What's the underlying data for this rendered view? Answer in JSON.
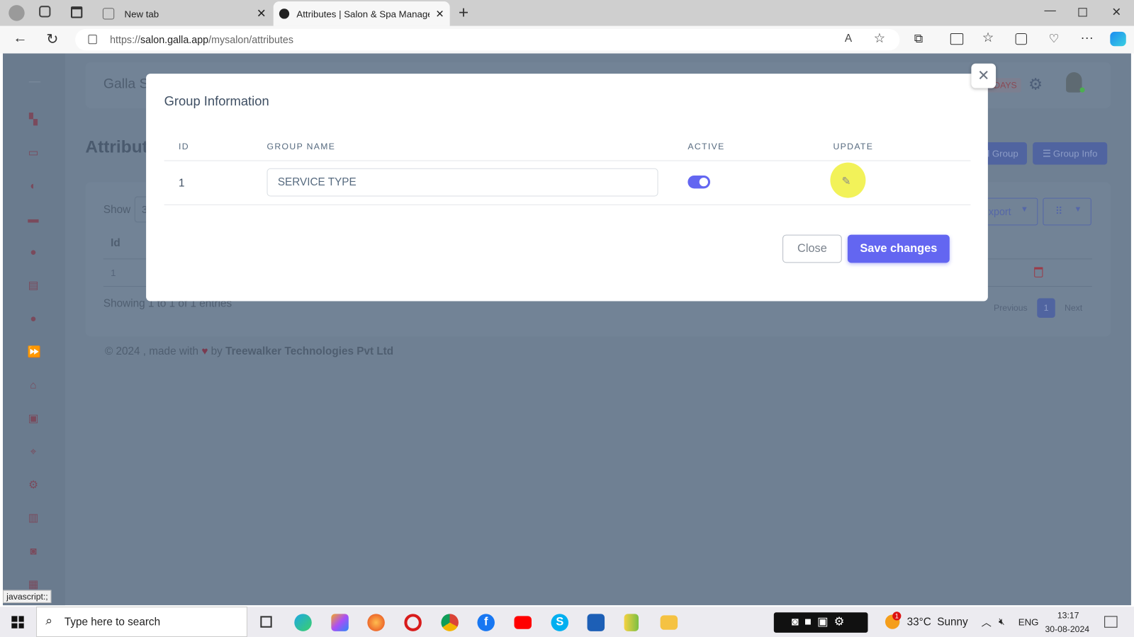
{
  "browser": {
    "tabs": [
      {
        "label": "New tab",
        "active": false
      },
      {
        "label": "Attributes | Salon & Spa Managem",
        "active": true
      }
    ],
    "url_prefix": "https://",
    "url_host": "salon.galla.app",
    "url_path": "/mysalon/attributes",
    "status_text": "javascript:;"
  },
  "app": {
    "brand_partial": "Galla S",
    "page_title_partial": "Attribut",
    "days_badge_partial": "DAYS",
    "buttons": {
      "add_group_partial": "l Group",
      "group_info": "Group Info",
      "export_partial": "xport"
    },
    "show_label": "Show",
    "show_value_partial": "3",
    "table": {
      "header_id": "Id",
      "row_id": "1"
    },
    "showing_text": "Showing 1 to 1 of 1 entries",
    "pagination": {
      "previous": "Previous",
      "current": "1",
      "next": "Next"
    },
    "footer": {
      "prefix": "© 2024 , made with",
      "by": "by",
      "company": "Treewalker Technologies Pvt Ltd"
    },
    "sidebar_icons": [
      "dashboard-icon",
      "folder-icon",
      "contrast-icon",
      "ticket-icon",
      "user-icon",
      "document-icon",
      "user-circle-icon",
      "forward-icon",
      "basket-icon",
      "contacts-icon",
      "location-icon",
      "gear-icon",
      "report-icon",
      "camera-icon",
      "calendar-icon"
    ]
  },
  "modal": {
    "title": "Group Information",
    "columns": [
      "ID",
      "GROUP NAME",
      "ACTIVE",
      "UPDATE"
    ],
    "rows": [
      {
        "id": "1",
        "group_name": "SERVICE TYPE",
        "active": true
      }
    ],
    "close_label": "Close",
    "save_label": "Save changes"
  },
  "taskbar": {
    "search_placeholder": "Type here to search",
    "weather": "33°C  Sunny",
    "weather_badge": "1",
    "language": "ENG",
    "time": "13:17",
    "date": "30-08-2024"
  },
  "colors": {
    "accent": "#6366f1",
    "overlay": "#6f8093",
    "danger": "#c0392b"
  }
}
